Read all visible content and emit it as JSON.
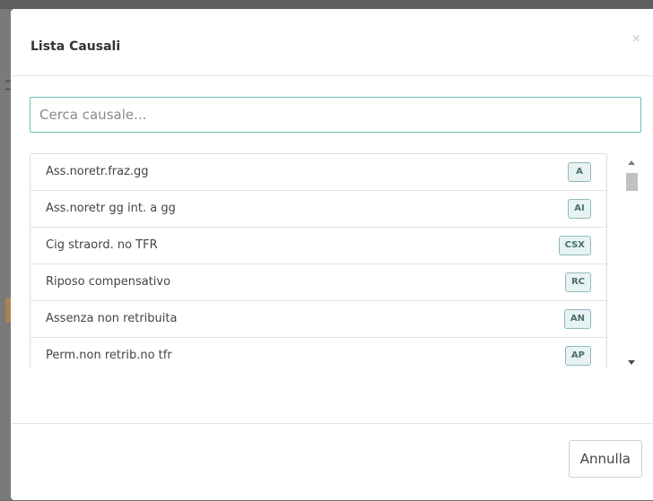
{
  "modal": {
    "title": "Lista Causali",
    "close_symbol": "×"
  },
  "search": {
    "placeholder": "Cerca causale...",
    "value": ""
  },
  "list": {
    "items": [
      {
        "label": "Ass.noretr.fraz.gg",
        "code": "A"
      },
      {
        "label": "Ass.noretr gg int. a gg",
        "code": "AI"
      },
      {
        "label": "Cig straord. no TFR",
        "code": "CSX"
      },
      {
        "label": "Riposo compensativo",
        "code": "RC"
      },
      {
        "label": "Assenza non retribuita",
        "code": "AN"
      },
      {
        "label": "Perm.non retrib.no tfr",
        "code": "AP"
      }
    ]
  },
  "footer": {
    "cancel_label": "Annulla"
  }
}
